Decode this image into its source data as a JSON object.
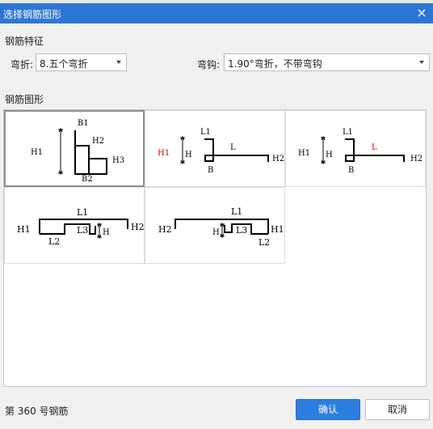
{
  "dialog": {
    "title": "选择钢筋图形"
  },
  "features": {
    "section_label": "钢筋特征",
    "bend_label": "弯折:",
    "bend_value": "8.五个弯折",
    "hook_label": "弯钩:",
    "hook_value": "1.90°弯折，不带弯钩"
  },
  "shapes": {
    "section_label": "钢筋图形",
    "items": [
      {
        "labels": [
          "B1",
          "H2",
          "H1",
          "H3",
          "B2"
        ]
      },
      {
        "labels": [
          "L1",
          "L",
          "H1",
          "H",
          "H2",
          "B"
        ]
      },
      {
        "labels": [
          "L1",
          "L",
          "H1",
          "H",
          "H2",
          "B"
        ]
      },
      {
        "labels": [
          "L1",
          "H1",
          "L3",
          "H",
          "H2",
          "L2"
        ]
      },
      {
        "labels": [
          "L1",
          "H2",
          "H",
          "L3",
          "H1",
          "L2"
        ]
      }
    ]
  },
  "colors": {
    "title_bar": "#2e76d6",
    "primary_button": "#2e7ee0",
    "highlight_label": "#cc0000"
  },
  "status": {
    "text": "第 360 号钢筋"
  },
  "buttons": {
    "ok": "确认",
    "cancel": "取消"
  }
}
